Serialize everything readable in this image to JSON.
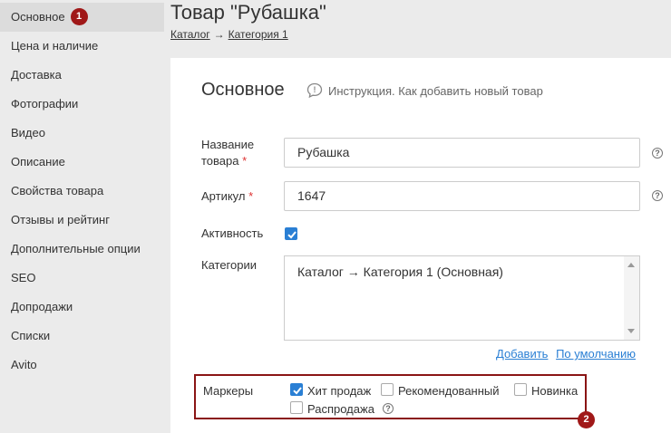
{
  "sidebar": {
    "items": [
      {
        "label": "Основное",
        "badge": "1"
      },
      {
        "label": "Цена и наличие"
      },
      {
        "label": "Доставка"
      },
      {
        "label": "Фотографии"
      },
      {
        "label": "Видео"
      },
      {
        "label": "Описание"
      },
      {
        "label": "Свойства товара"
      },
      {
        "label": "Отзывы и рейтинг"
      },
      {
        "label": "Дополнительные опции"
      },
      {
        "label": "SEO"
      },
      {
        "label": "Допродажи"
      },
      {
        "label": "Списки"
      },
      {
        "label": "Avito"
      }
    ]
  },
  "header": {
    "title": "Товар \"Рубашка\"",
    "breadcrumb": {
      "item1": "Каталог",
      "separator": "→",
      "item2": "Категория 1"
    }
  },
  "main": {
    "section_title": "Основное",
    "help_link": "Инструкция. Как добавить новый товар",
    "fields": {
      "name": {
        "label_line1": "Название",
        "label_line2": "товара",
        "required": "*",
        "value": "Рубашка",
        "help": "?"
      },
      "article": {
        "label": "Артикул",
        "required": "*",
        "value": "1647",
        "help": "?"
      },
      "active": {
        "label": "Активность",
        "checked": true
      },
      "categories": {
        "label": "Категории",
        "value": "Каталог → Категория 1 (Основная)"
      }
    },
    "category_links": {
      "add": "Добавить",
      "default": "По умолчанию"
    },
    "markers": {
      "label": "Маркеры",
      "items": [
        {
          "label": "Хит продаж",
          "checked": true
        },
        {
          "label": "Рекомендованный",
          "checked": false
        },
        {
          "label": "Новинка",
          "checked": false
        },
        {
          "label": "Распродажа",
          "checked": false
        }
      ],
      "help": "?",
      "badge": "2"
    }
  },
  "colors": {
    "accent": "#2a7fd4",
    "badge": "#a01818",
    "highlight_border": "#8a1515",
    "required": "#dd3333"
  }
}
